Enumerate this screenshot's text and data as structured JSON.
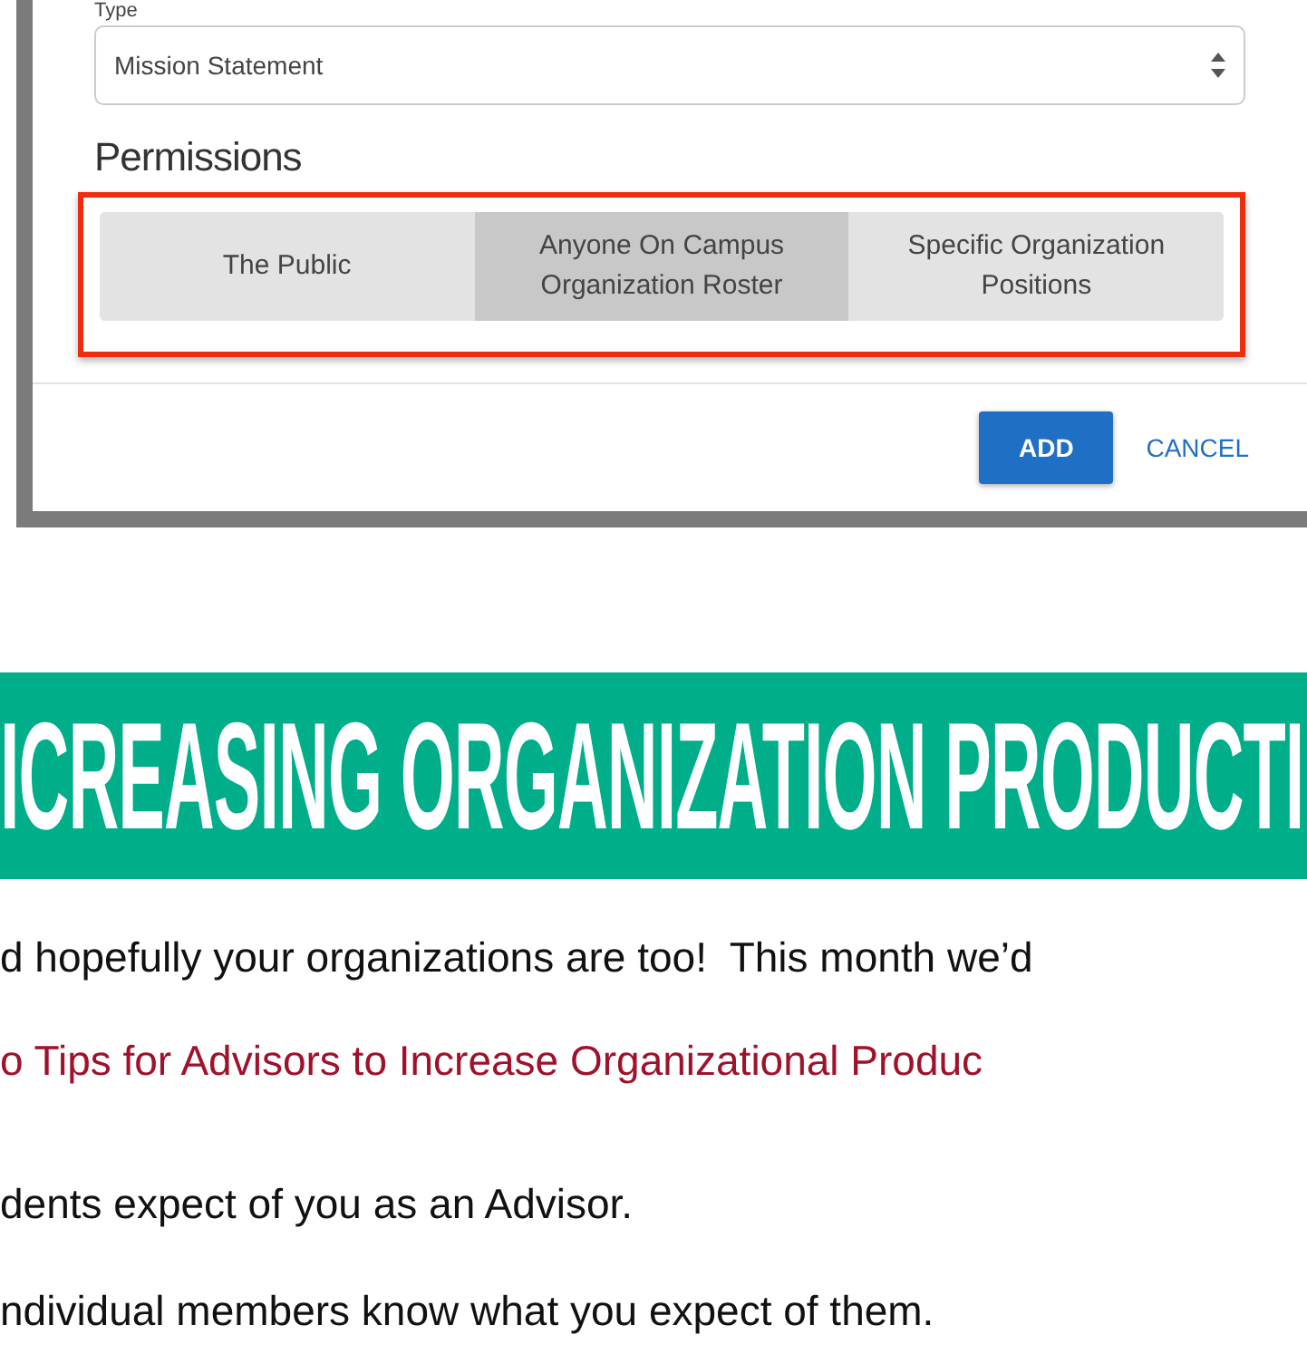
{
  "dialog": {
    "type_field": {
      "label": "Type",
      "value": "Mission Statement"
    },
    "permissions": {
      "heading": "Permissions",
      "options": [
        {
          "label": "The Public",
          "selected": false
        },
        {
          "label": "Anyone On Campus\nOrganization Roster",
          "selected": true
        },
        {
          "label": "Specific Organization\nPositions",
          "selected": false
        }
      ]
    },
    "buttons": [
      {
        "label": "ADD",
        "kind": "primary"
      },
      {
        "label": "CANCEL",
        "kind": "link"
      }
    ]
  },
  "banner": {
    "title": "ICREASING ORGANIZATION PRODUCTI"
  },
  "article": {
    "paragraphs": [
      {
        "text": "d hopefully your organizations are too!  This month we’d",
        "kind": "text"
      },
      {
        "text": "o Tips for Advisors to Increase Organizational Produc",
        "kind": "link"
      },
      {
        "text": "dents expect of you as an Advisor.",
        "kind": "text"
      },
      {
        "text": "ndividual members know what you expect of them.",
        "kind": "text"
      }
    ]
  }
}
